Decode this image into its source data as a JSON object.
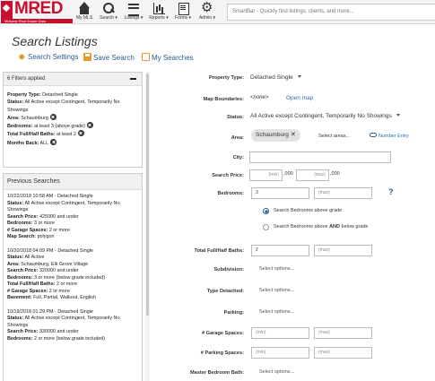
{
  "nav": {
    "logo_text": "MRED",
    "logo_sub": "Midwest Real Estate Data",
    "items": [
      {
        "label": "My MLS"
      },
      {
        "label": "Search ▾"
      },
      {
        "label": "Listings ▾"
      },
      {
        "label": "Reports ▾"
      },
      {
        "label": "Forms ▾"
      },
      {
        "label": "Admin ▾"
      }
    ],
    "smartbar_placeholder": "SmartBar - Quickly find listings, clients, and more..."
  },
  "page": {
    "title": "Search Listings",
    "toolbar": {
      "settings": "Search Settings",
      "save": "Save Search",
      "my_searches": "My Searches"
    }
  },
  "filters": {
    "header": "6 Filters applied",
    "items": [
      {
        "label": "Property Type:",
        "value": "Detached Single"
      },
      {
        "label": "Status:",
        "value": "All Active except Contingent, Temporarily No Showings"
      },
      {
        "label": "Area:",
        "value": "Schaumburg"
      },
      {
        "label": "Bedrooms:",
        "value": "at least 3 (above grade)"
      },
      {
        "label": "Total Full/Half Baths:",
        "value": "at least 2"
      },
      {
        "label": "Months Back:",
        "value": "ALL"
      }
    ]
  },
  "previous": {
    "header": "Previous Searches",
    "entries": [
      {
        "title": "10/22/2018 10:58 AM - Detached Single",
        "lines": [
          {
            "k": "Status:",
            "v": "All Active except Contingent, Temporarily No Showings"
          },
          {
            "k": "Search Price:",
            "v": "425000 and under"
          },
          {
            "k": "Bedrooms:",
            "v": "3 or more"
          },
          {
            "k": "# Garage Spaces:",
            "v": "2 or more"
          },
          {
            "k": "Map Search:",
            "v": "polygon"
          }
        ]
      },
      {
        "title": "10/20/2018 04:09 PM - Detached Single",
        "lines": [
          {
            "k": "Status:",
            "v": "All Active"
          },
          {
            "k": "Area:",
            "v": "Schaumburg, Elk Grove Village"
          },
          {
            "k": "Search Price:",
            "v": "320000 and under"
          },
          {
            "k": "Bedrooms:",
            "v": "3 or more (below grade included)"
          },
          {
            "k": "Total Full/Half Baths:",
            "v": "2 or more"
          },
          {
            "k": "# Garage Spaces:",
            "v": "2 or more"
          },
          {
            "k": "Basement:",
            "v": "Full, Partial, Walkout, English"
          }
        ]
      },
      {
        "title": "10/19/2018 01:29 PM - Detached Single",
        "lines": [
          {
            "k": "Status:",
            "v": "All Active except Contingent, Temporarily No Showings"
          },
          {
            "k": "Search Price:",
            "v": "330000 and under"
          },
          {
            "k": "Bedrooms:",
            "v": "2 or more (below grade included)"
          }
        ]
      }
    ]
  },
  "form": {
    "property_type": {
      "label": "Property Type:",
      "value": "Detached Single"
    },
    "map_boundaries": {
      "label": "Map Boundaries:",
      "value": "<none>",
      "link": "Open map"
    },
    "status": {
      "label": "Status:",
      "value": "All Active except Contingent, Temporarily No Showings"
    },
    "area": {
      "label": "Area:",
      "chip": "Schaumburg",
      "select": "Select areas...",
      "number_entry": "Number Entry"
    },
    "city": {
      "label": "City:"
    },
    "search_price": {
      "label": "Search Price:",
      "min": "(min)",
      "max": "(max)",
      "suffix": ",000"
    },
    "bedrooms": {
      "label": "Bedrooms:",
      "min_value": "3",
      "max": "(max)",
      "help": "?",
      "opt_above": "Search Bedrooms above grade",
      "opt_below_prefix": "Search Bedrooms above ",
      "opt_below_and": "AND",
      "opt_below_suffix": " below grade"
    },
    "baths": {
      "label": "Total Full/Half Baths:",
      "min_value": "2",
      "max": "(max)"
    },
    "subdivision": {
      "label": "Subdivision:",
      "select": "Select options..."
    },
    "type_detached": {
      "label": "Type Detached:",
      "select": "Select options..."
    },
    "parking": {
      "label": "Parking:",
      "select": "Select options..."
    },
    "garage": {
      "label": "# Garage Spaces:",
      "min": "(min)",
      "max": "(max)"
    },
    "parking_spaces": {
      "label": "# Parking Spaces:",
      "min": "(min)",
      "max": "(max)"
    },
    "master_bath": {
      "label": "Master Bedroom Bath:",
      "select": "Select options..."
    }
  }
}
